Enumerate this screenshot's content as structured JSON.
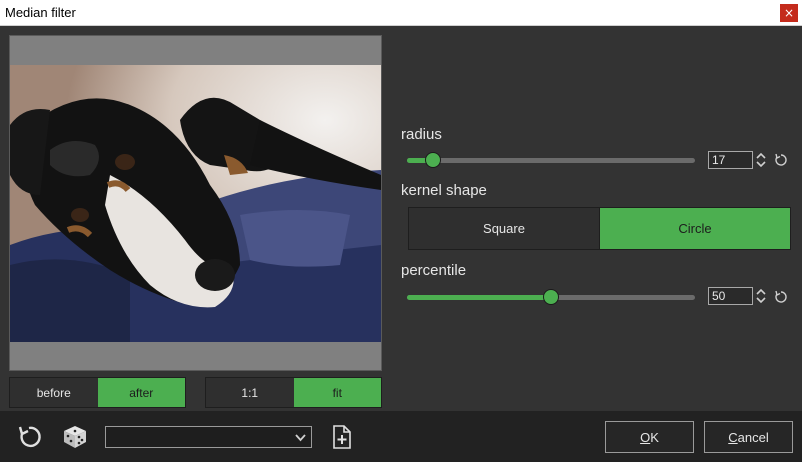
{
  "window": {
    "title": "Median filter",
    "close_label": "×"
  },
  "preview": {
    "compare": {
      "before_label": "before",
      "after_label": "after",
      "selected": "after"
    },
    "zoom": {
      "one_to_one_label": "1:1",
      "fit_label": "fit",
      "selected": "fit"
    }
  },
  "controls": {
    "radius": {
      "label": "radius",
      "value": "17",
      "slider_fraction": 0.09
    },
    "kernel_shape": {
      "label": "kernel shape",
      "options": [
        "Square",
        "Circle"
      ],
      "selected": "Circle"
    },
    "percentile": {
      "label": "percentile",
      "value": "50",
      "slider_fraction": 0.5
    }
  },
  "footer": {
    "preset_value": "",
    "ok_mnemonic": "O",
    "ok_rest": "K",
    "cancel_mnemonic": "C",
    "cancel_rest": "ancel"
  },
  "colors": {
    "accent": "#4caf50",
    "panel": "#333333",
    "footer": "#222222"
  },
  "icons": {
    "reset": "reset-icon",
    "random": "dice-icon",
    "new_preset": "new-file-icon",
    "spin": "spin-arrows-icon",
    "slider_reset": "reset-small-icon"
  }
}
